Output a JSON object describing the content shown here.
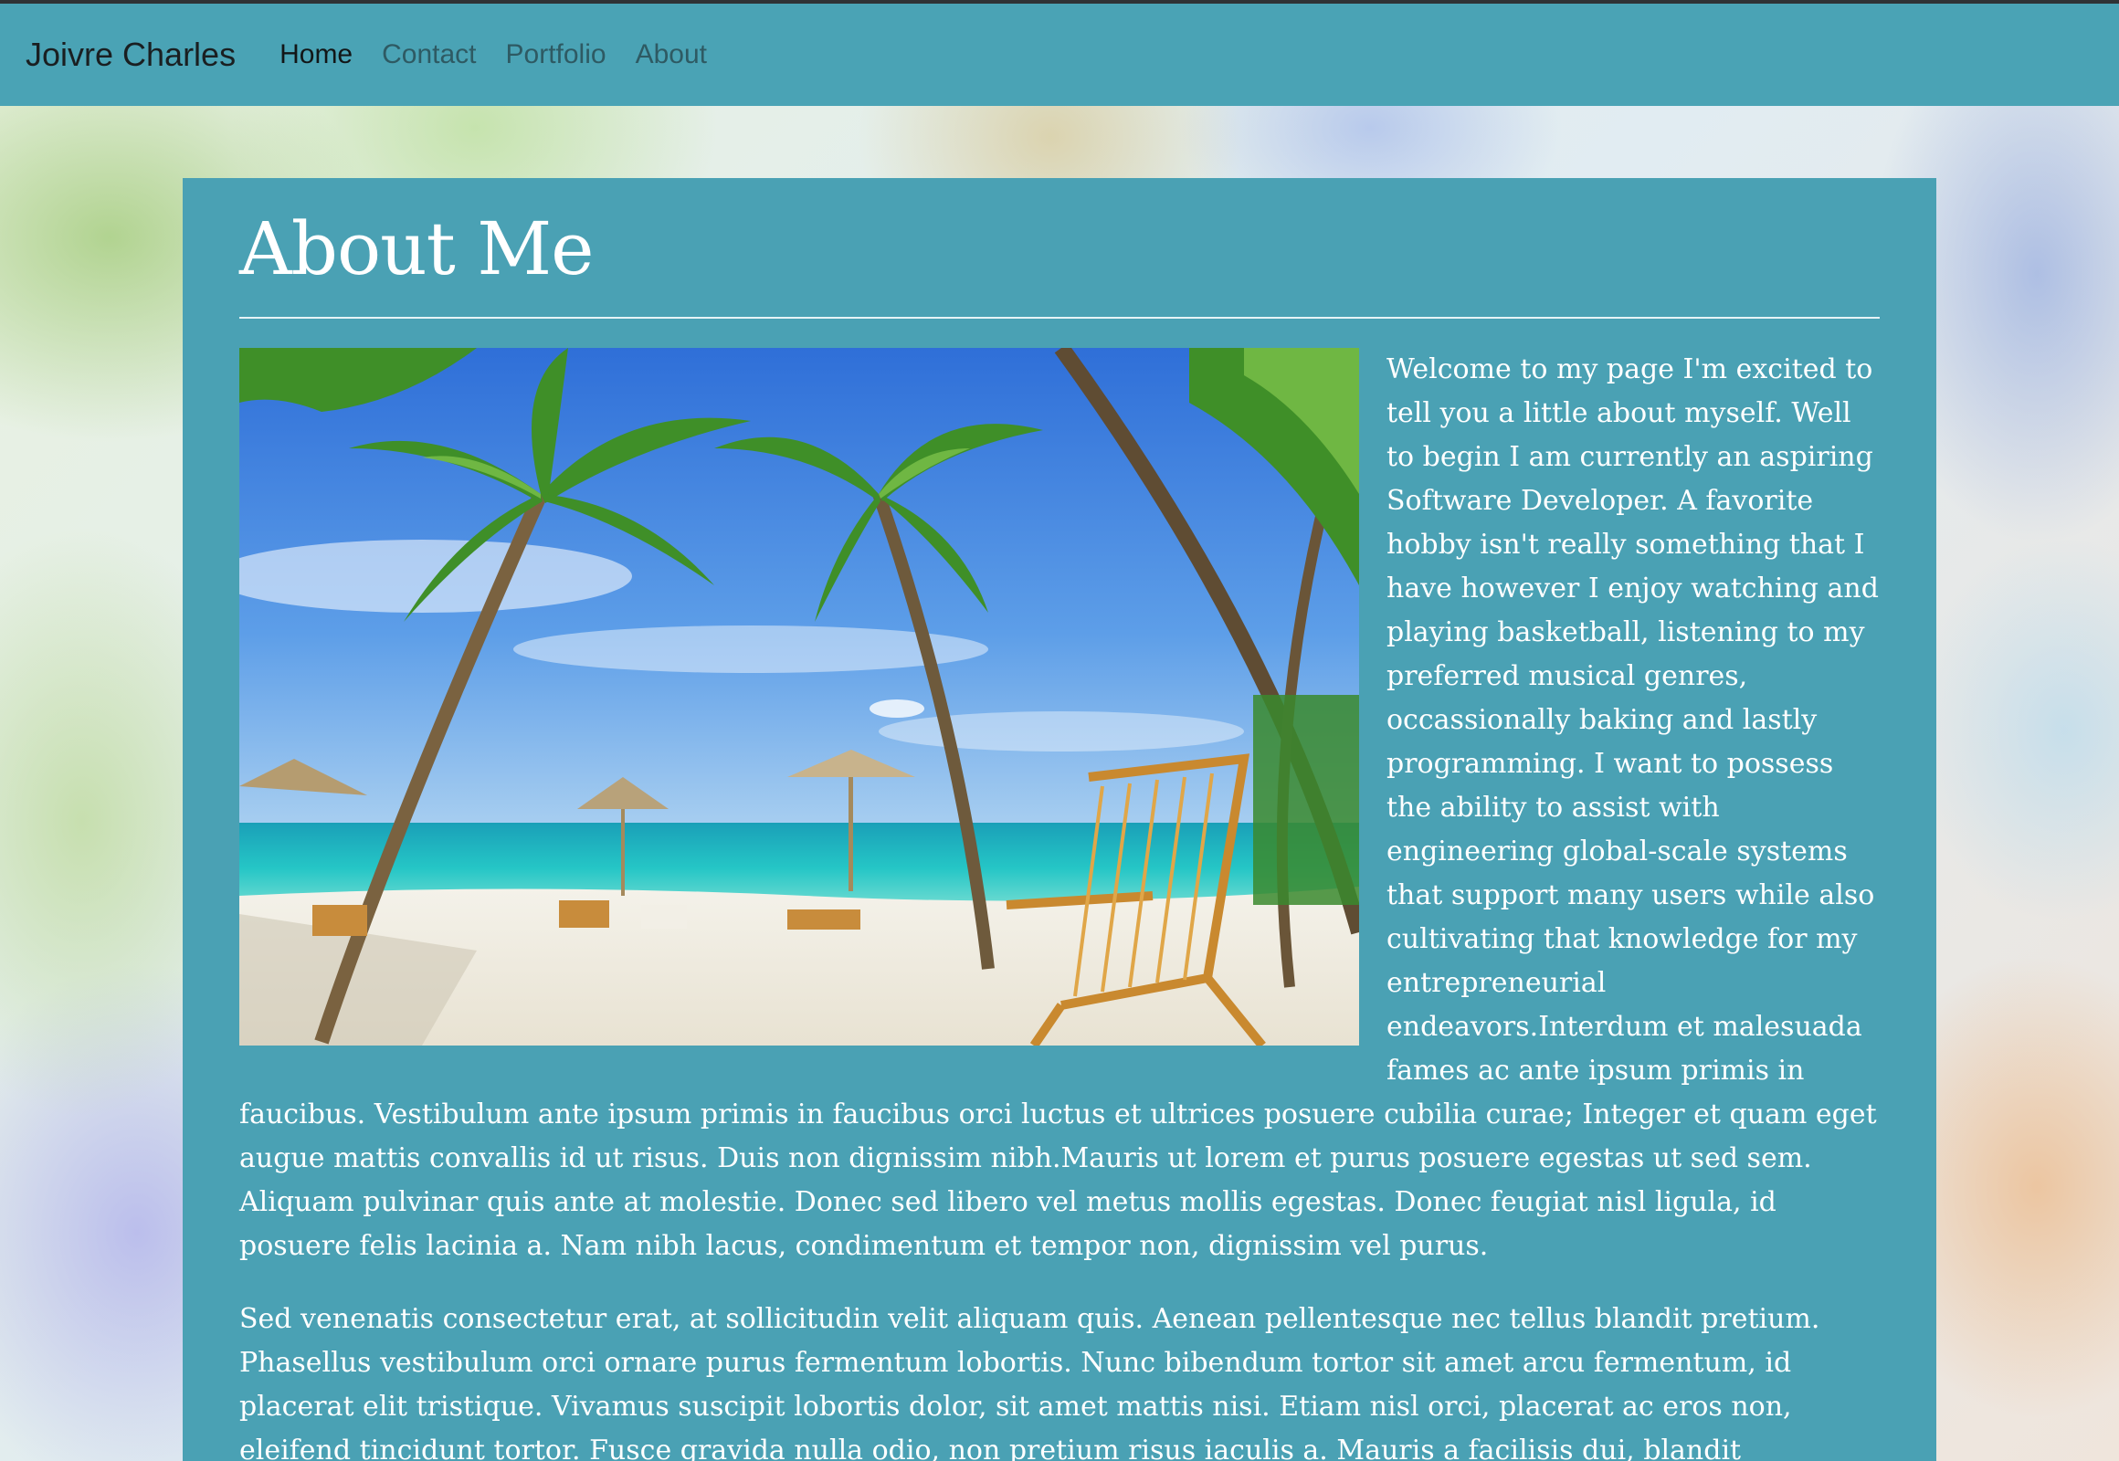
{
  "navbar": {
    "brand": "Joivre Charles",
    "links": [
      "Home",
      "Contact",
      "Portfolio",
      "About"
    ],
    "active": "Home"
  },
  "main": {
    "title": "About Me",
    "image": {
      "alt": "tropical beach with palm trees, umbrellas and a wooden lounge chair"
    },
    "paragraphs": [
      "Welcome to my page I'm excited to tell you a little about myself. Well to begin I am currently an aspiring Software Developer. A favorite hobby isn't really something that I have however I enjoy watching and playing basketball, listening to my preferred musical genres, occassionally baking and lastly programming. I want to possess the ability to assist with engineering global-scale systems that support many users while also cultivating that knowledge for my entrepreneurial endeavors.Interdum et malesuada fames ac ante ipsum primis in faucibus. Vestibulum ante ipsum primis in faucibus orci luctus et ultrices posuere cubilia curae; Integer et quam eget augue mattis convallis id ut risus. Duis non dignissim nibh.Mauris ut lorem et purus posuere egestas ut sed sem. Aliquam pulvinar quis ante at molestie. Donec sed libero vel metus mollis egestas. Donec feugiat nisl ligula, id posuere felis lacinia a. Nam nibh lacus, condimentum et tempor non, dignissim vel purus.",
      "Sed venenatis consectetur erat, at sollicitudin velit aliquam quis. Aenean pellentesque nec tellus blandit pretium. Phasellus vestibulum orci ornare purus fermentum lobortis. Nunc bibendum tortor sit amet arcu fermentum, id placerat elit tristique. Vivamus suscipit lobortis dolor, sit amet mattis nisi. Etiam nisl orci, placerat ac eros non, eleifend tincidunt tortor. Fusce gravida nulla odio, non pretium risus iaculis a. Mauris a facilisis dui, blandit elementum metus."
    ]
  },
  "colors": {
    "navbar": "#4aa3b5",
    "card": "#4aa1b4",
    "text": "#ffffff"
  }
}
